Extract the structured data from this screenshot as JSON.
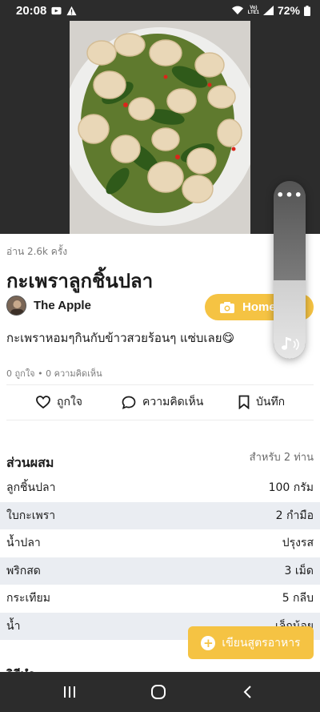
{
  "status_bar": {
    "time": "20:08",
    "battery": "72%",
    "network": "Vo)\nLTE1"
  },
  "recipe": {
    "reads": "อ่าน 2.6k ครั้ง",
    "title": "กะเพราลูกชิ้นปลา",
    "author": "The Apple",
    "home_button_label": "Home",
    "description": "กะเพราหอมๆกินกับข้าวสวยร้อนๆ แซ่บเลย😋",
    "stats": "0 ถูกใจ • 0 ความคิดเห็น"
  },
  "actions": {
    "like": "ถูกใจ",
    "comment": "ความคิดเห็น",
    "save": "บันทึก"
  },
  "ingredients": {
    "title": "ส่วนผสม",
    "serves": "สำหรับ 2 ท่าน",
    "items": [
      {
        "name": "ลูกชิ้นปลา",
        "amount": "100 กรัม"
      },
      {
        "name": "ใบกะเพรา",
        "amount": "2 กำมือ"
      },
      {
        "name": "น้ำปลา",
        "amount": "ปรุงรส"
      },
      {
        "name": "พริกสด",
        "amount": "3 เม็ด"
      },
      {
        "name": "กระเทียม",
        "amount": "5 กลีบ"
      },
      {
        "name": "น้ำ",
        "amount": "เล็กน้อย"
      }
    ]
  },
  "write_recipe_label": "เขียนสูตรอาหาร",
  "next_section_title": "วิธีทำ",
  "volume": {
    "level": 0.44
  },
  "colors": {
    "accent": "#f5c343",
    "alt_row": "#eaedf2",
    "bars": "#2c2c2c"
  }
}
